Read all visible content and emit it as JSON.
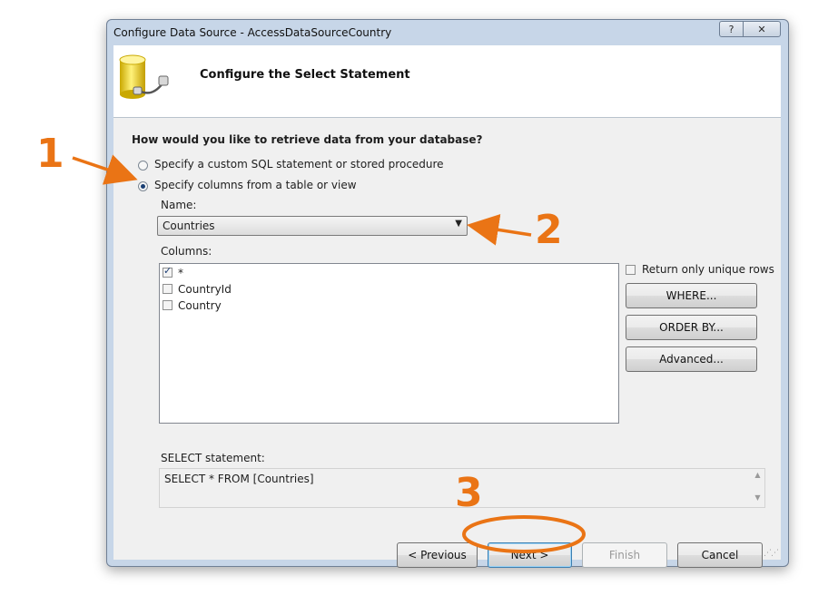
{
  "window": {
    "title": "Configure Data Source - AccessDataSourceCountry",
    "help_label": "?",
    "close_label": "✕"
  },
  "header": {
    "title": "Configure the Select Statement"
  },
  "body": {
    "question": "How would you like to retrieve data from your database?",
    "option_custom": "Specify a custom SQL statement or stored procedure",
    "option_columns": "Specify columns from a table or view",
    "name_label": "Name:",
    "name_value": "Countries",
    "columns_label": "Columns:",
    "columns": [
      {
        "label": "*",
        "checked": true
      },
      {
        "label": "CountryId",
        "checked": false
      },
      {
        "label": "Country",
        "checked": false
      }
    ],
    "unique_rows_label": "Return only unique rows",
    "where_button": "WHERE...",
    "orderby_button": "ORDER BY...",
    "advanced_button": "Advanced...",
    "select_label": "SELECT statement:",
    "select_text": "SELECT * FROM [Countries]"
  },
  "footer": {
    "previous": "< Previous",
    "next": "Next >",
    "finish": "Finish",
    "cancel": "Cancel"
  },
  "annotations": {
    "one": "1",
    "two": "2",
    "three": "3"
  },
  "colors": {
    "annotation": "#ea7415",
    "accent": "#3c7fb1"
  }
}
